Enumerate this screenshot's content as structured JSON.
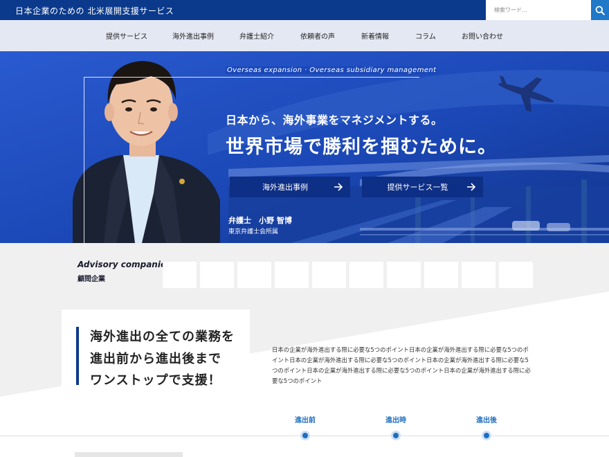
{
  "header": {
    "site_title": "日本企業のための 北米展開支援サービス",
    "search_placeholder": "検索ワード…",
    "search_icon": "search-icon"
  },
  "nav": {
    "items": [
      "提供サービス",
      "海外進出事例",
      "弁護士紹介",
      "依頼者の声",
      "新着情報",
      "コラム",
      "お問い合わせ"
    ]
  },
  "hero": {
    "overseas_label": "Overseas expansion · Overseas subsidiary management",
    "subheading": "日本から、海外事業をマネジメントする。",
    "heading": "世界市場で勝利を掴むために。",
    "buttons": [
      "海外進出事例",
      "提供サービス一覧"
    ],
    "lawyer_name": "弁護士　小野 智博",
    "affiliation": "東京弁護士会所属",
    "colors": {
      "primary": "#0b3a8c",
      "hero_blue": "#1a47b8",
      "button": "#0e2f86"
    }
  },
  "advisory": {
    "title_en": "Advisory companies",
    "title_jp": "顧問企業",
    "logo_count": 10
  },
  "feature": {
    "lines": [
      "海外進出の全ての業務を",
      "進出前から進出後まで",
      "ワンストップで支援！"
    ],
    "body": "日本の企業が海外進出する際に必要な5つのポイント日本の企業が海外進出する際に必要な5つのポイント日本の企業が海外進出する際に必要な5つのポイント日本の企業が海外進出する際に必要な5つのポイント日本の企業が海外進出する際に必要な5つのポイント日本の企業が海外進出する際に必要な5つのポイント"
  },
  "timeline": {
    "steps": [
      "進出前",
      "進出時",
      "進出後"
    ],
    "accent": "#1f6fc0"
  }
}
